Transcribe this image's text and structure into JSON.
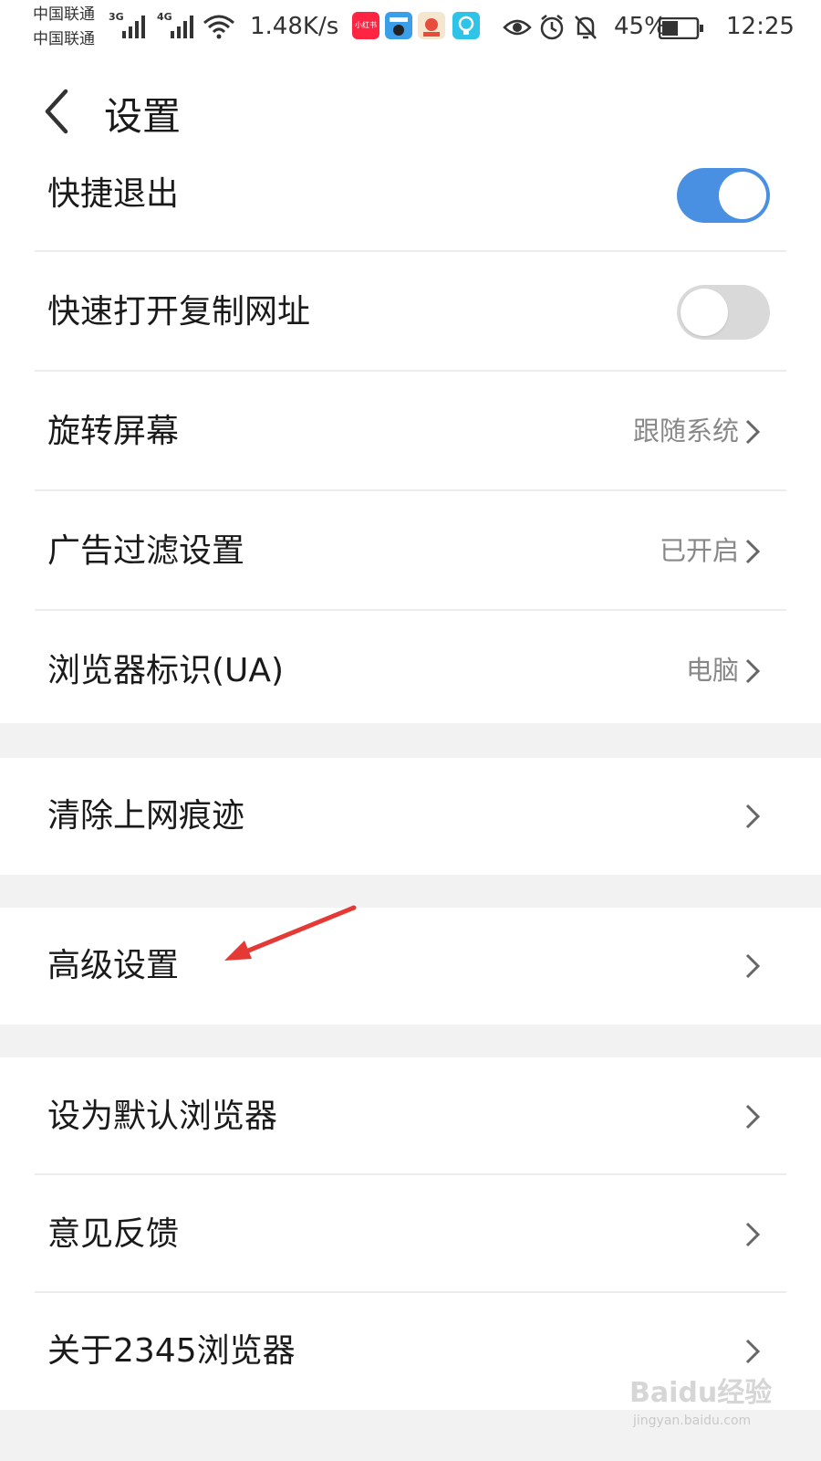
{
  "status_bar": {
    "carrier1": "中国联通",
    "carrier2": "中国联通",
    "net1": "3G",
    "net2": "4G",
    "speed": "1.48K/s",
    "app_icon_label": "小红书",
    "battery": "45%",
    "time": "12:25"
  },
  "header": {
    "title": "设置"
  },
  "toggle_items": [
    {
      "label": "快捷退出",
      "on": true
    },
    {
      "label": "快速打开复制网址",
      "on": false
    }
  ],
  "value_items": [
    {
      "label": "旋转屏幕",
      "value": "跟随系统"
    },
    {
      "label": "广告过滤设置",
      "value": "已开启"
    },
    {
      "label": "浏览器标识(UA)",
      "value": "电脑"
    }
  ],
  "clear_item": {
    "label": "清除上网痕迹"
  },
  "advanced_item": {
    "label": "高级设置"
  },
  "bottom_items": [
    {
      "label": "设为默认浏览器"
    },
    {
      "label": "意见反馈"
    },
    {
      "label": "关于2345浏览器"
    }
  ],
  "colors": {
    "accent": "#4a90e2",
    "toggle_off": "#d9d9d9",
    "annotation_arrow": "#e53935"
  },
  "watermark": {
    "brand": "Baidu经验",
    "url": "jingyan.baidu.com"
  }
}
